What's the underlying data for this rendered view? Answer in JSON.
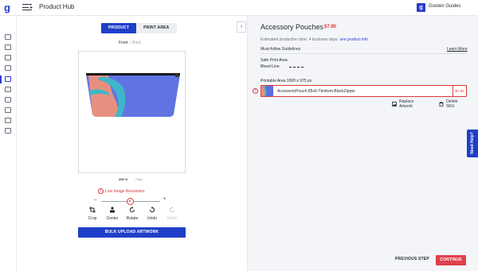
{
  "header": {
    "logo_letter": "g",
    "app_title": "Product Hub",
    "user_badge": "g",
    "user_name": "Gooten Guides"
  },
  "sidebar": {
    "icons": [
      "home-icon",
      "orders-icon",
      "store-icon",
      "catalog-icon",
      "hub-icon",
      "reports-icon",
      "products-icon",
      "sync-icon",
      "billing-icon",
      "inbox-icon",
      "settings-icon"
    ],
    "active_index": 4
  },
  "editor": {
    "tabs": [
      {
        "label": "PRODUCT",
        "active": true
      },
      {
        "label": "PRINT AREA",
        "active": false
      }
    ],
    "collapse_glyph": "›",
    "view_front": "Front",
    "view_separator": "|",
    "view_back": "Back",
    "zoom_value": "266 %",
    "dpi_value": "75dpi",
    "warning_text": "Low Image Resolution",
    "warning_glyph": "!",
    "slider_minus": "–",
    "slider_plus": "+",
    "tools": [
      {
        "label": "Crop",
        "icon": "crop-icon",
        "enabled": true
      },
      {
        "label": "Center",
        "icon": "center-icon",
        "enabled": true
      },
      {
        "label": "Rotate",
        "icon": "rotate-icon",
        "enabled": true
      },
      {
        "label": "Undo",
        "icon": "undo-icon",
        "enabled": true
      },
      {
        "label": "Redo",
        "icon": "redo-icon",
        "enabled": false
      }
    ],
    "bulk_upload_label": "BULK UPLOAD ARTWORK"
  },
  "details": {
    "product_title": "Accessory Pouches",
    "product_price": "$7.90",
    "est_production": "Estimated production time: 4 business days",
    "see_product_info": "see product info",
    "guidelines_label": "Must-follow Guidelines",
    "learn_more": "Learn More",
    "safe_print_area": "Safe Print Area",
    "bleed_line": "Bleed Line",
    "printable_area": "Printable Area 1500 x 975 px",
    "artwork_name": "AccessoryPouch-85x6-Tbottom-BlackZipper",
    "artwork_price": "$7.90",
    "artwork_warning_glyph": "!",
    "replace_artwork": "Replace Artwork",
    "delete_sku": "Delete SKU"
  },
  "footer": {
    "previous_step": "PREVIOUS STEP",
    "continue": "CONTINUE"
  },
  "need_help": "Need Help?",
  "colors": {
    "primary": "#1f3fc9",
    "danger": "#d83a3a",
    "continue": "#e0404a",
    "pouch_blue": "#5a6fe0",
    "pouch_teal": "#3fb6c9",
    "pouch_skin": "#e89080"
  }
}
